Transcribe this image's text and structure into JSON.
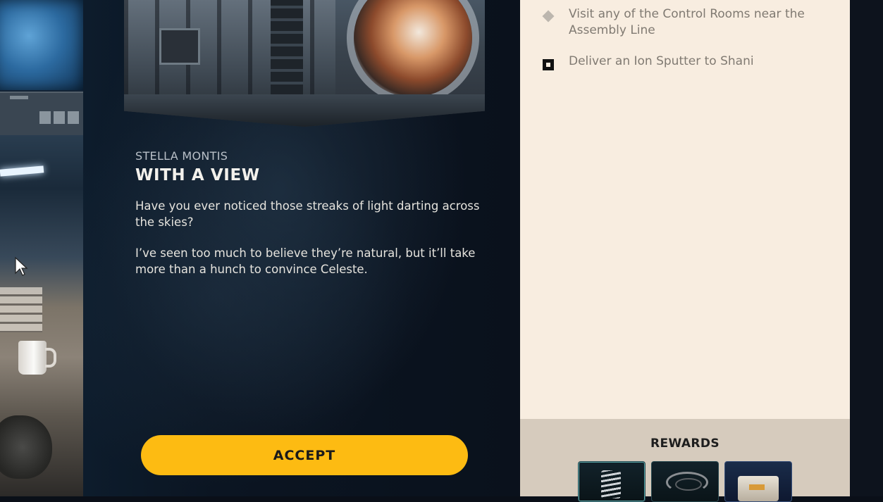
{
  "mission": {
    "location": "STELLA MONTIS",
    "title": "WITH A VIEW",
    "description": [
      "Have you ever noticed those streaks of light darting across the skies?",
      "I’ve seen too much to believe they’re natural, but it’ll take more than a hunch to convince Celeste."
    ],
    "accept_label": "ACCEPT"
  },
  "objectives": [
    {
      "icon": "diamond-icon",
      "text": "Visit any of the Control Rooms near the Assembly Line"
    },
    {
      "icon": "checkbox-icon",
      "text": "Deliver an Ion Sputter to Shani"
    }
  ],
  "rewards": {
    "title": "REWARDS",
    "items": [
      {
        "icon": "spring-icon"
      },
      {
        "icon": "cable-icon"
      },
      {
        "icon": "crate-icon"
      }
    ]
  },
  "colors": {
    "accept_button": "#fdbb12",
    "objectives_background": "#f8ede0",
    "rewards_background": "#d6cbbd",
    "panel_background": "#0b1522"
  }
}
